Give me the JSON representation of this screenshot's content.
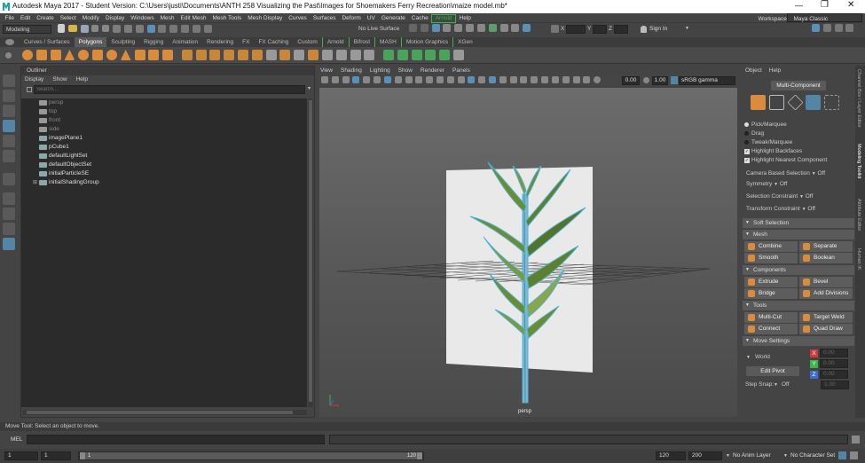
{
  "titlebar": {
    "title": "Autodesk Maya 2017 - Student Version: C:\\Users\\justi\\Documents\\ANTH 258 Visualizing the Past\\Images for Shoemakers Ferry Recreation\\maize model.mb*"
  },
  "menus": [
    "File",
    "Edit",
    "Create",
    "Select",
    "Modify",
    "Display",
    "Windows",
    "Mesh",
    "Edit Mesh",
    "Mesh Tools",
    "Mesh Display",
    "Curves",
    "Surfaces",
    "Deform",
    "UV",
    "Generate",
    "Cache",
    "Arnold",
    "Help"
  ],
  "workspace": {
    "label": "Workspace :",
    "value": "Maya Classic"
  },
  "statusline": {
    "mode": "Modeling",
    "live_surface": "No Live Surface",
    "x_label": "X",
    "y_label": "Y",
    "z_label": "Z",
    "sign_in": "Sign In"
  },
  "shelf_tabs": [
    "Curves / Surfaces",
    "Polygons",
    "Sculpting",
    "Rigging",
    "Animation",
    "Rendering",
    "FX",
    "FX Caching",
    "Custom",
    "Arnold",
    "Bifrost",
    "MASH",
    "Motion Graphics",
    "XGen"
  ],
  "shelf_active": "Polygons",
  "outliner": {
    "title": "Outliner",
    "menus": [
      "Display",
      "Show",
      "Help"
    ],
    "search_placeholder": "Search...",
    "items": [
      {
        "label": "persp",
        "dim": true
      },
      {
        "label": "top",
        "dim": true
      },
      {
        "label": "front",
        "dim": true
      },
      {
        "label": "side",
        "dim": true
      },
      {
        "label": "imagePlane1",
        "dim": false
      },
      {
        "label": "pCube1",
        "dim": false
      },
      {
        "label": "defaultLightSet",
        "dim": false
      },
      {
        "label": "defaultObjectSet",
        "dim": false
      },
      {
        "label": "initialParticleSE",
        "dim": false
      },
      {
        "label": "initialShadingGroup",
        "dim": false
      }
    ]
  },
  "viewport": {
    "menus": [
      "View",
      "Shading",
      "Lighting",
      "Show",
      "Renderer",
      "Panels"
    ],
    "near": "0.00",
    "far": "1.00",
    "color_space": "sRGB gamma",
    "camera_label": "persp"
  },
  "modeling_toolkit": {
    "menus": [
      "Object",
      "Help"
    ],
    "mode_button": "Multi-Component",
    "options": [
      "Pick/Marquee",
      "Drag",
      "Tweak/Marquee"
    ],
    "checkboxes": [
      "Highlight Backfaces",
      "Highlight Nearest Component"
    ],
    "camera_selection": {
      "label": "Camera Based Selection",
      "value": "Off"
    },
    "symmetry": {
      "label": "Symmetry",
      "value": "Off"
    },
    "selection_constraint": {
      "label": "Selection Constraint",
      "value": "Off"
    },
    "transform_constraint": {
      "label": "Transform Constraint",
      "value": "Off"
    },
    "soft_selection": "Soft Selection",
    "sections": {
      "mesh": "Mesh",
      "components": "Components",
      "tools": "Tools",
      "move": "Move Settings"
    },
    "mesh_buttons": [
      "Combine",
      "Separate",
      "Smooth",
      "Boolean"
    ],
    "component_buttons": [
      "Extrude",
      "Bevel",
      "Bridge",
      "Add Divisions"
    ],
    "tool_buttons": [
      "Multi-Cut",
      "Target Weld",
      "Connect",
      "Quad Draw"
    ],
    "move": {
      "space": "World",
      "x": "X",
      "y": "Y",
      "z": "Z",
      "x_val": "0.00",
      "y_val": "0.00",
      "z_val": "0.00",
      "edit_pivot": "Edit Pivot",
      "step_snap": "Step Snap:",
      "step_value": "Off",
      "step_num": "1.00"
    }
  },
  "right_tabs": [
    "Channel Box / Layer Editor",
    "Modeling Toolkit",
    "Attribute Editor",
    "Human IK"
  ],
  "helpline": "Move Tool: Select an object to move.",
  "mel": {
    "label": "MEL"
  },
  "timeslider": {
    "start": "1",
    "current": "1",
    "range_start": "1",
    "range_end": "120",
    "end_field": "120",
    "anim_end": "200",
    "anim_layer": "No Anim Layer",
    "char_set": "No Character Set"
  },
  "colors": {
    "accent": "#5285a6",
    "highlight": "#4fb3d9",
    "arnold": "#39b54a",
    "xaxis": "#d13a3a",
    "yaxis": "#39b54a",
    "zaxis": "#3a6fd1"
  }
}
